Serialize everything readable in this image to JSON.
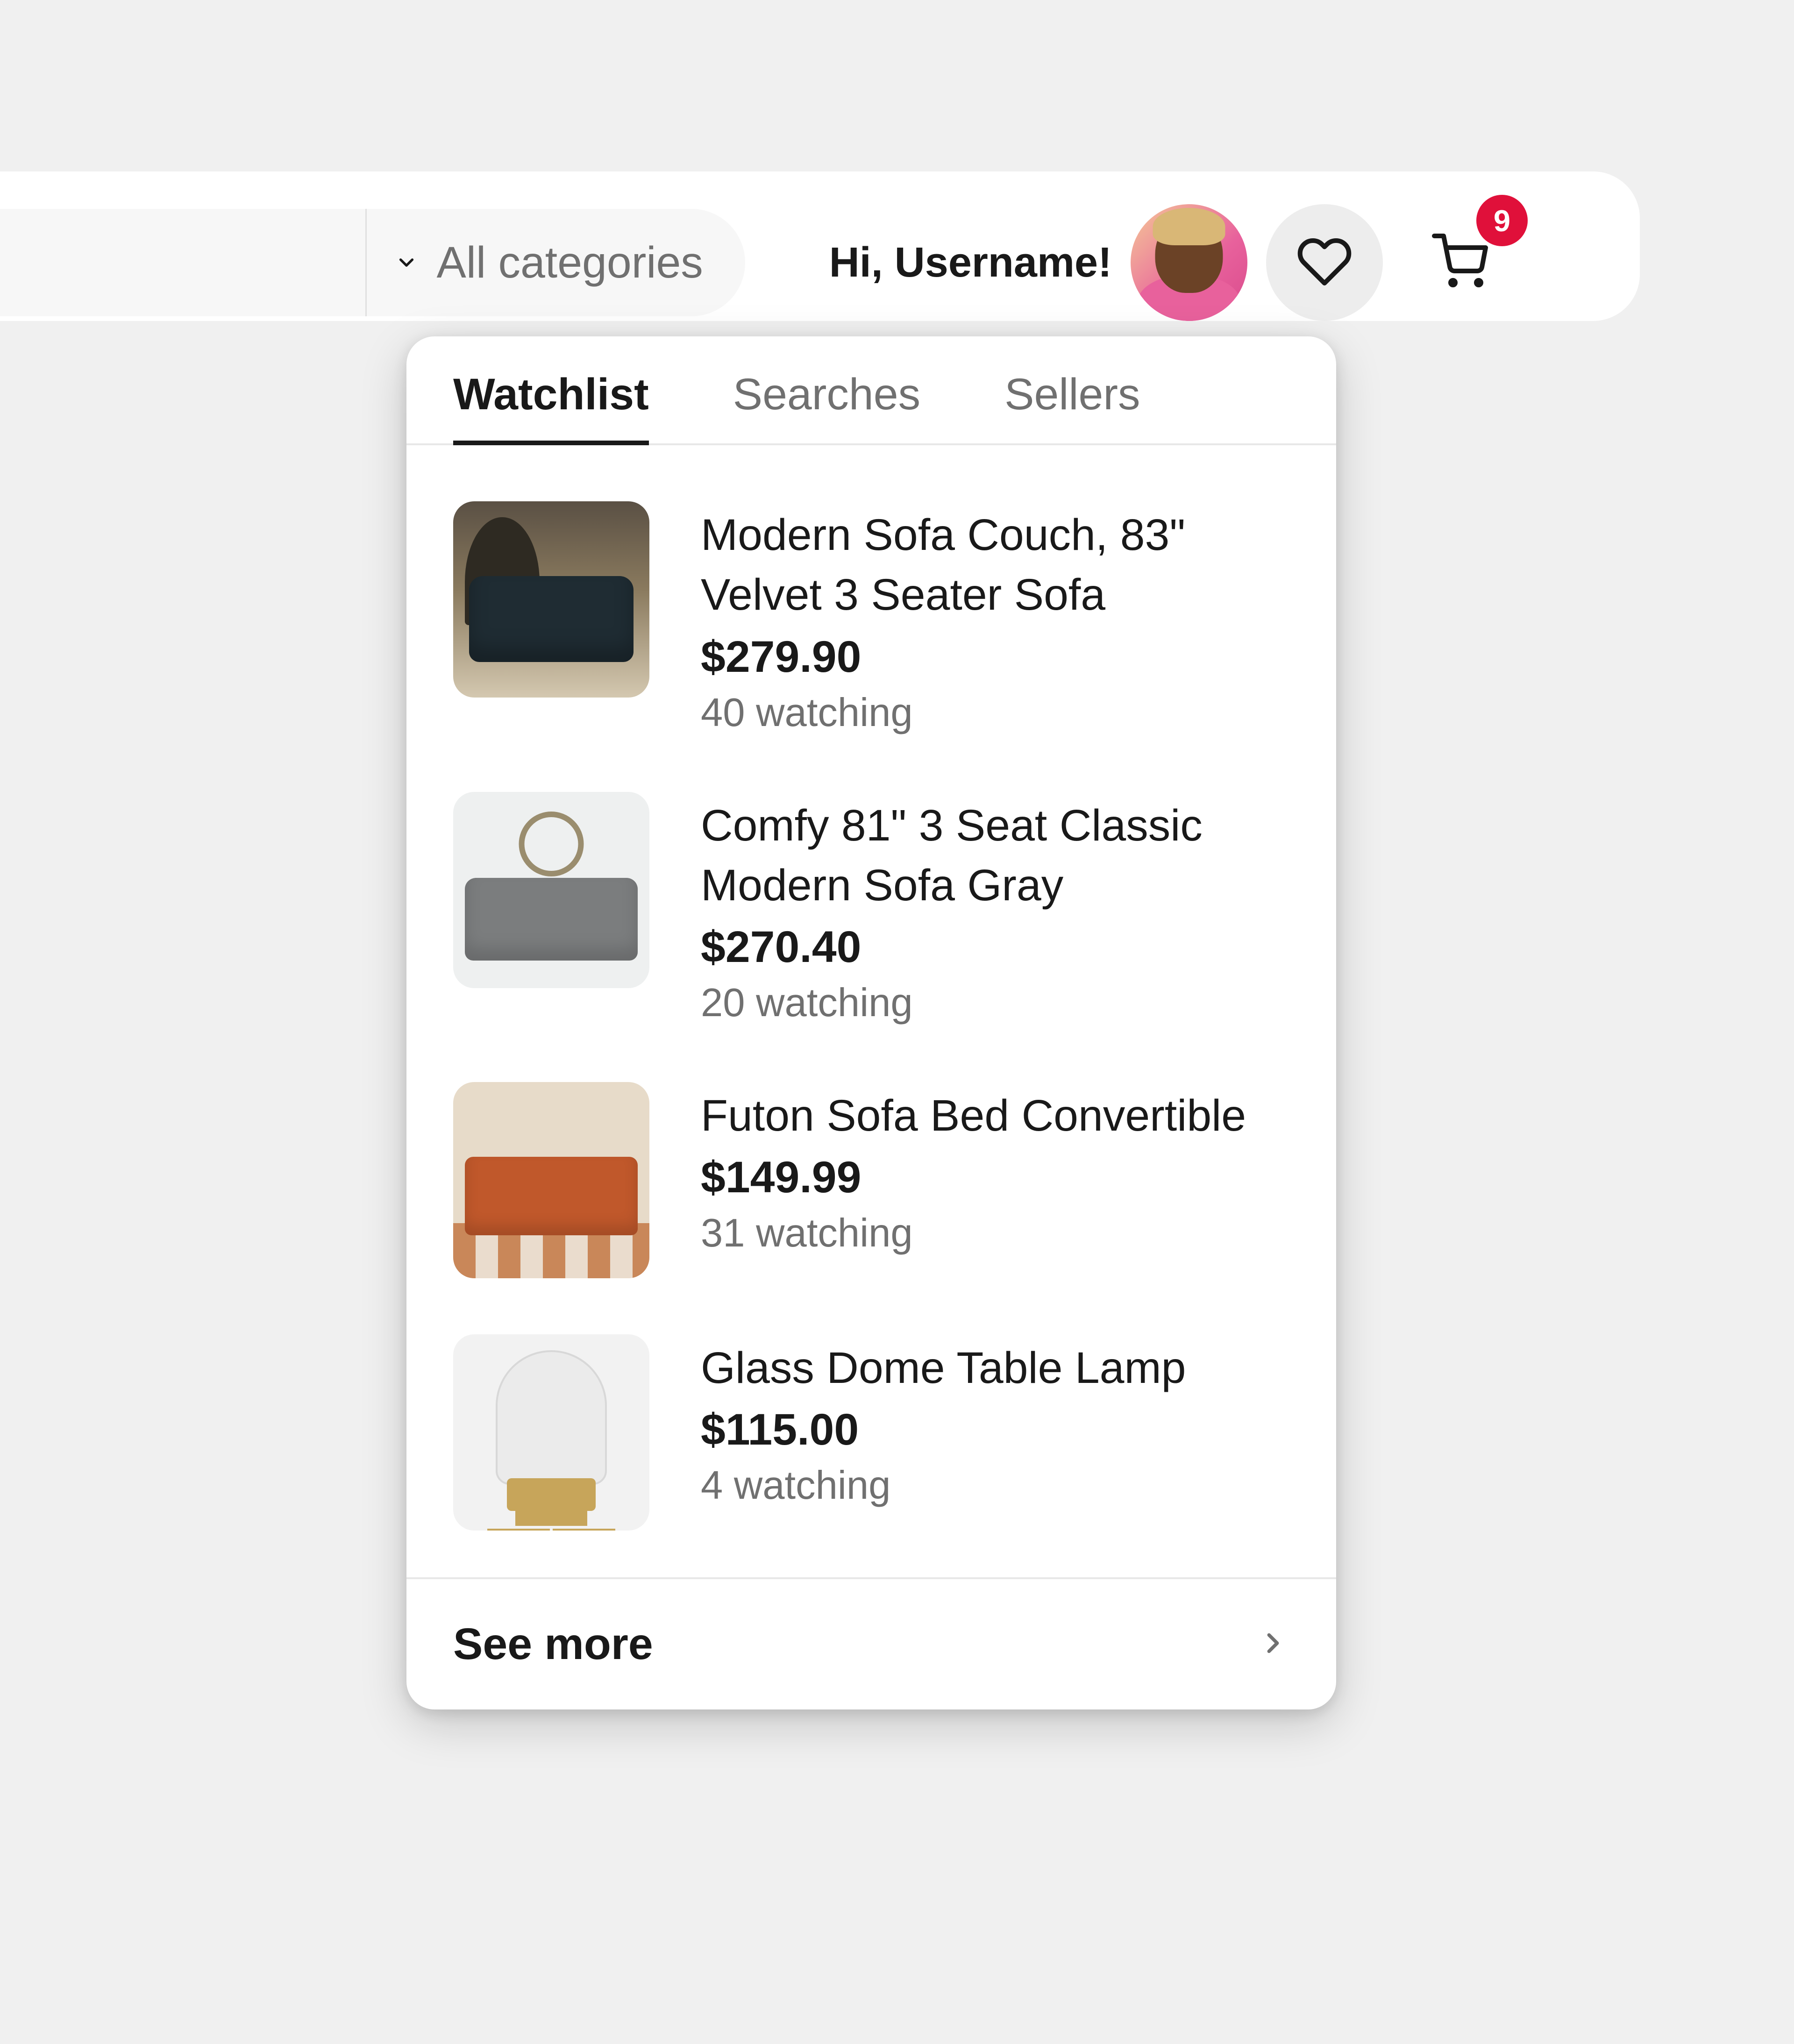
{
  "header": {
    "category_label": "All categories",
    "greeting": "Hi, Username!",
    "cart_badge": "9"
  },
  "dropdown": {
    "tabs": [
      {
        "label": "Watchlist",
        "active": true
      },
      {
        "label": "Searches",
        "active": false
      },
      {
        "label": "Sellers",
        "active": false
      }
    ],
    "items": [
      {
        "title": "Modern Sofa Couch, 83\" Velvet 3 Seater Sofa",
        "price": "$279.90",
        "watching": "40 watching"
      },
      {
        "title": "Comfy 81\" 3 Seat Classic Modern Sofa Gray",
        "price": "$270.40",
        "watching": "20 watching"
      },
      {
        "title": "Futon Sofa Bed Convertible",
        "price": "$149.99",
        "watching": "31 watching"
      },
      {
        "title": "Glass Dome Table Lamp",
        "price": "$115.00",
        "watching": "4 watching"
      }
    ],
    "see_more": "See more"
  }
}
